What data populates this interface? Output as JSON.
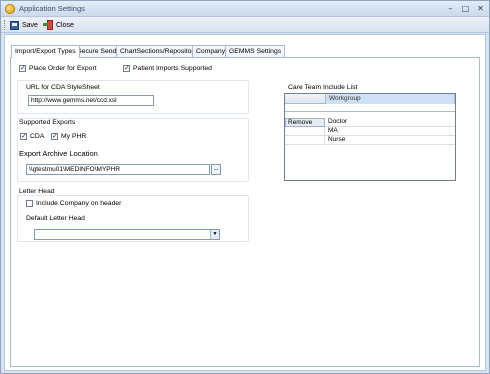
{
  "window": {
    "title": "Application Settings",
    "controls": {
      "minimize": "–",
      "maximize": "□",
      "close": "✕"
    }
  },
  "toolbar": {
    "save_label": "Save",
    "close_label": "Close",
    "save_icon": "save-disk-icon",
    "close_icon": "exit-door-icon"
  },
  "tabs": [
    {
      "label": "Import/Export Types",
      "active": true
    },
    {
      "label": "Secure Send",
      "active": false
    },
    {
      "label": "ChartSections/Repository",
      "active": false
    },
    {
      "label": "Company",
      "active": false
    },
    {
      "label": "GEMMS Settings",
      "active": false
    }
  ],
  "options": {
    "place_order_label": "Place Order for Export",
    "place_order_checked": true,
    "patient_imports_label": "Patient Imports Supported",
    "patient_imports_checked": true
  },
  "stylesheet": {
    "label": "URL for CDA StyleSheet",
    "value": "http://www.gemms.net/ccd.xsl"
  },
  "supported_exports": {
    "label": "Supported Exports",
    "cda_label": "CDA",
    "cda_checked": true,
    "myphr_label": "My PHR",
    "myphr_checked": true
  },
  "archive": {
    "label": "Export Archive Location",
    "value": "\\\\gtestmu01\\MEDINFO\\MYPHR",
    "browse_label": "..."
  },
  "letter_head": {
    "label": "Letter Head",
    "include_company_label": "Include Company on header",
    "include_company_checked": false,
    "default_label": "Default Letter Head",
    "default_value": ""
  },
  "care_team": {
    "label": "Care Team Include List",
    "column_header": "Workgroup",
    "rows": [
      {
        "action": "Remove",
        "workgroup": "Doctor"
      },
      {
        "action": "",
        "workgroup": "MA"
      },
      {
        "action": "",
        "workgroup": "Nurse"
      }
    ]
  }
}
